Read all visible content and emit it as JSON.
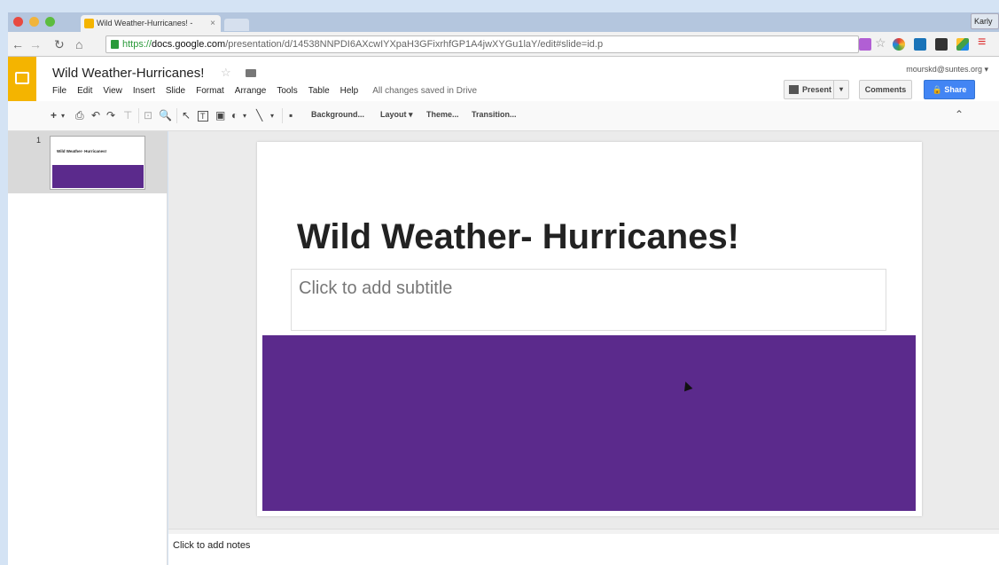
{
  "browser": {
    "tab_title": "Wild Weather-Hurricanes! -",
    "tab_close": "×",
    "profile": "Karly",
    "url_proto": "https://",
    "url_host": "docs.google.com",
    "url_path": "/presentation/d/14538NNPDI6AXcwIYXpaH3GFixrhfGP1A4jwXYGu1laY/edit#slide=id.p"
  },
  "header": {
    "title": "Wild Weather-Hurricanes!",
    "user_email": "mourskd@suntes.org",
    "menu": [
      "File",
      "Edit",
      "View",
      "Insert",
      "Slide",
      "Format",
      "Arrange",
      "Tools",
      "Table",
      "Help"
    ],
    "save_status": "All changes saved in Drive",
    "present_label": "Present",
    "comments_label": "Comments",
    "share_label": "Share"
  },
  "toolbar": {
    "background_label": "Background...",
    "layout_label": "Layout",
    "theme_label": "Theme...",
    "transition_label": "Transition..."
  },
  "filmstrip": {
    "slide_number": "1",
    "thumb_title": "Wild Weather- Hurricanes!"
  },
  "slide": {
    "title": "Wild Weather- Hurricanes!",
    "subtitle_placeholder": "Click to add subtitle",
    "accent_color": "#5b2a8c"
  },
  "notes": {
    "placeholder": "Click to add notes"
  }
}
